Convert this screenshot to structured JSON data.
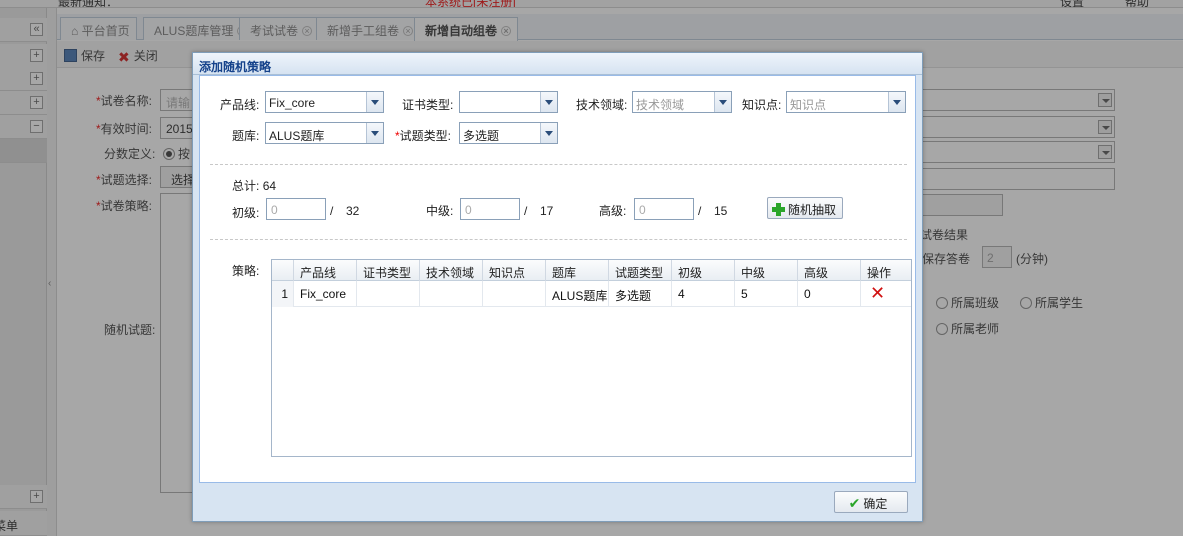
{
  "topbar": {
    "notice": "最新通知：",
    "notice_red": "本系统已[未注册]",
    "settings": "设置",
    "help": "帮助"
  },
  "tabs": [
    {
      "label": "平台首页"
    },
    {
      "label": "ALUS题库管理"
    },
    {
      "label": "考试试卷"
    },
    {
      "label": "新增手工组卷"
    },
    {
      "label": "新增自动组卷"
    }
  ],
  "toolbar": {
    "save": "保存",
    "close": "关闭"
  },
  "bg_form": {
    "name_label": "试卷名称:",
    "name_value": "请输",
    "time_label": "有效时间:",
    "time_value": "2015",
    "score_label": "分数定义:",
    "score_value": "按",
    "select_label": "试题选择:",
    "select_value": "选择",
    "strategy_label": "试卷策略:",
    "random_label": "随机试题:",
    "result_label": "试卷结果",
    "save_answer_label": "保存答卷",
    "save_answer_value": "2",
    "minutes": "(分钟)",
    "radio_class": "所属班级",
    "radio_student": "所属学生",
    "radio_teacher": "所属老师",
    "sidebar_bottom": "菜单"
  },
  "dialog": {
    "title": "添加随机策略",
    "product_line_label": "产品线:",
    "product_line_value": "Fix_core",
    "cert_type_label": "证书类型:",
    "cert_type_value": "",
    "tech_field_label": "技术领域:",
    "tech_field_placeholder": "技术领域",
    "knowledge_label": "知识点:",
    "knowledge_placeholder": "知识点",
    "bank_label": "题库:",
    "bank_value": "ALUS题库",
    "qtype_label": "试题类型:",
    "qtype_value": "多选题",
    "total_label": "总计:",
    "total_value": "64",
    "basic_label": "初级:",
    "basic_value": "0",
    "basic_max": "32",
    "mid_label": "中级:",
    "mid_value": "0",
    "mid_max": "17",
    "adv_label": "高级:",
    "adv_value": "0",
    "adv_max": "15",
    "slash": "/",
    "random_button": "随机抽取",
    "strategy_label": "策略:",
    "columns": [
      "产品线",
      "证书类型",
      "技术领域",
      "知识点",
      "题库",
      "试题类型",
      "初级",
      "中级",
      "高级",
      "操作"
    ],
    "rows": [
      {
        "num": "1",
        "product_line": "Fix_core",
        "cert_type": "",
        "tech_field": "",
        "knowledge": "",
        "bank": "ALUS题库",
        "qtype": "多选题",
        "basic": "4",
        "mid": "5",
        "adv": "0"
      }
    ],
    "ok_button": "确定"
  }
}
